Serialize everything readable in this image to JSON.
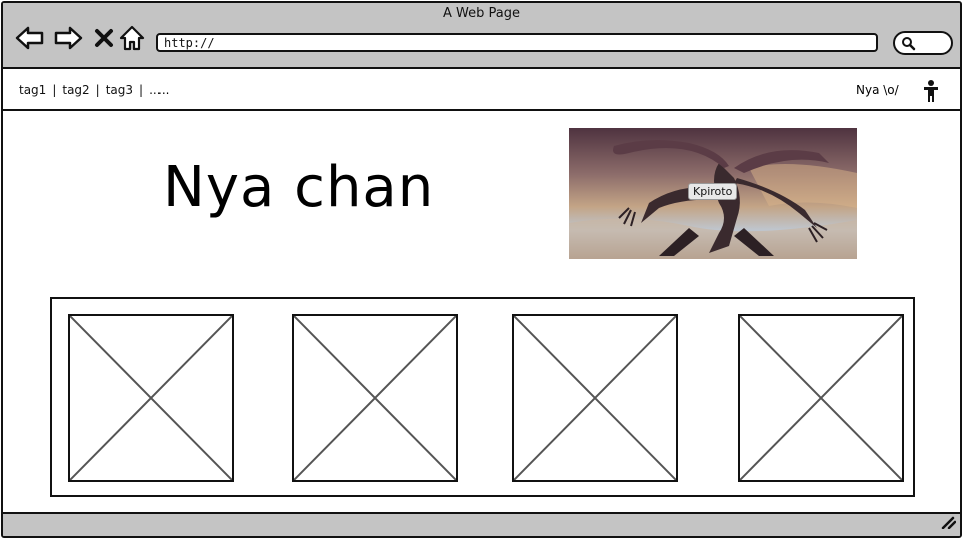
{
  "window": {
    "title": "A Web Page"
  },
  "toolbar": {
    "icons": [
      "back-arrow-icon",
      "forward-arrow-icon",
      "close-x-icon",
      "home-icon",
      "search-icon"
    ],
    "address": "http://"
  },
  "tagbar": {
    "tags": [
      "tag1",
      "tag2",
      "tag3",
      "..."
    ],
    "ellipsis": "...",
    "user_name": "Nya \\o/",
    "user_icon": "person-icon"
  },
  "hero": {
    "title": "Nya chan",
    "image_caption": "Kpiroto"
  },
  "gallery": {
    "items": [
      {
        "icon": "image-placeholder-icon"
      },
      {
        "icon": "image-placeholder-icon"
      },
      {
        "icon": "image-placeholder-icon"
      },
      {
        "icon": "image-placeholder-icon"
      }
    ]
  },
  "statusbar": {
    "icon": "resize-grip-icon"
  }
}
